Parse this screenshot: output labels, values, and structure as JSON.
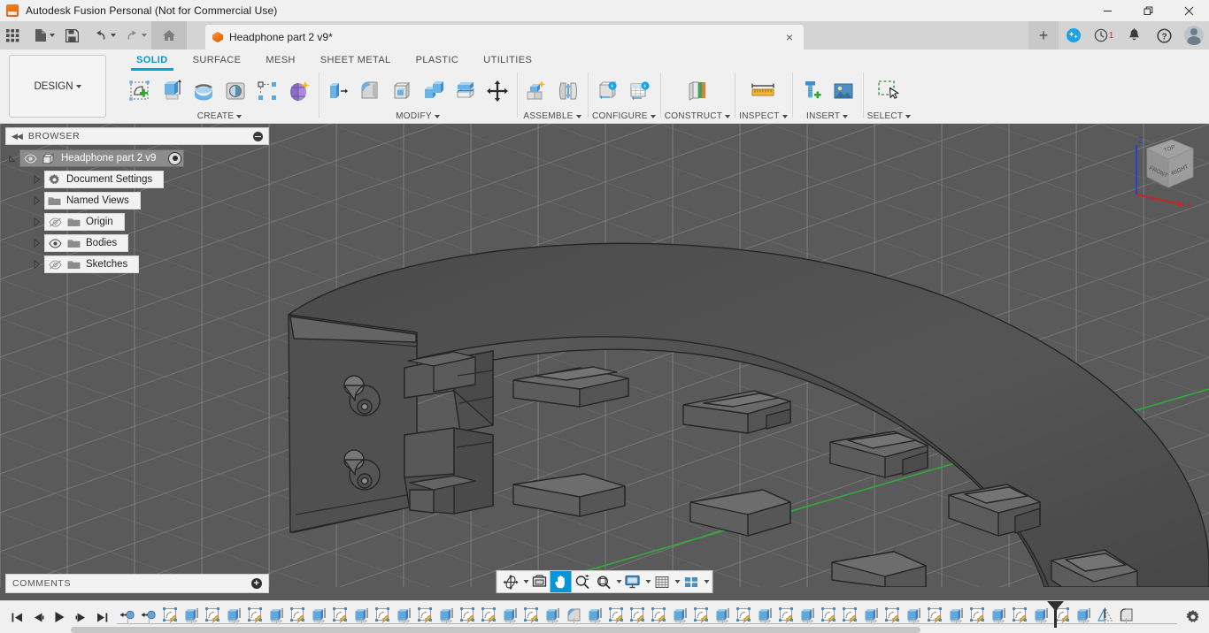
{
  "window": {
    "title": "Autodesk Fusion Personal (Not for Commercial Use)",
    "app_icon": "fusion-logo-icon",
    "minimize_label": "Minimize",
    "restore_label": "Restore",
    "close_label": "Close"
  },
  "quick_access": {
    "items": [
      {
        "name": "app-grid",
        "icon": "grid-apps-icon",
        "has_caret": false
      },
      {
        "name": "new-document",
        "icon": "file-new-icon",
        "has_caret": true
      },
      {
        "name": "save",
        "icon": "save-disk-icon",
        "has_caret": false
      },
      {
        "name": "undo",
        "icon": "undo-arrow-icon",
        "has_caret": true
      },
      {
        "name": "redo",
        "icon": "redo-arrow-icon",
        "has_caret": true
      },
      {
        "name": "home",
        "icon": "home-icon",
        "has_caret": false
      }
    ],
    "document_tab": {
      "icon": "orange-cube-icon",
      "label": "Headphone part 2 v9*",
      "close_label": "×"
    },
    "new_tab_label": "+",
    "right_icons": [
      {
        "name": "extensions",
        "icon": "sparkle-badge-icon",
        "badge": ""
      },
      {
        "name": "job-status",
        "icon": "clock-icon",
        "badge": "1"
      },
      {
        "name": "notifications",
        "icon": "bell-icon",
        "badge": ""
      },
      {
        "name": "help",
        "icon": "question-circle-icon",
        "badge": ""
      },
      {
        "name": "account",
        "icon": "avatar-icon",
        "badge": ""
      }
    ]
  },
  "ribbon": {
    "workspace_label": "DESIGN",
    "tabs": [
      {
        "label": "SOLID",
        "active": true
      },
      {
        "label": "SURFACE",
        "active": false
      },
      {
        "label": "MESH",
        "active": false
      },
      {
        "label": "SHEET METAL",
        "active": false
      },
      {
        "label": "PLASTIC",
        "active": false
      },
      {
        "label": "UTILITIES",
        "active": false
      }
    ],
    "active_tab_color": "#0696d7",
    "panels": [
      {
        "label": "CREATE",
        "has_caret": true,
        "icons": [
          {
            "name": "create-sketch-icon"
          },
          {
            "name": "extrude-icon"
          },
          {
            "name": "revolve-icon"
          },
          {
            "name": "sweep-icon"
          },
          {
            "name": "pattern-icon"
          },
          {
            "name": "form-icon"
          }
        ]
      },
      {
        "label": "MODIFY",
        "has_caret": true,
        "icons": [
          {
            "name": "press-pull-icon"
          },
          {
            "name": "fillet-icon"
          },
          {
            "name": "shell-icon"
          },
          {
            "name": "combine-icon"
          },
          {
            "name": "split-face-icon"
          },
          {
            "name": "move-copy-icon"
          }
        ]
      },
      {
        "label": "ASSEMBLE",
        "has_caret": true,
        "icons": [
          {
            "name": "new-component-icon"
          },
          {
            "name": "joint-icon"
          }
        ]
      },
      {
        "label": "CONFIGURE",
        "has_caret": true,
        "icons": [
          {
            "name": "configuration-icon"
          },
          {
            "name": "configuration-table-icon"
          }
        ]
      },
      {
        "label": "CONSTRUCT",
        "has_caret": true,
        "icons": [
          {
            "name": "offset-plane-icon"
          }
        ]
      },
      {
        "label": "INSPECT",
        "has_caret": true,
        "icons": [
          {
            "name": "measure-ruler-icon"
          }
        ]
      },
      {
        "label": "INSERT",
        "has_caret": true,
        "icons": [
          {
            "name": "insert-mcmaster-icon"
          },
          {
            "name": "insert-canvas-icon"
          }
        ]
      },
      {
        "label": "SELECT",
        "has_caret": true,
        "icons": [
          {
            "name": "window-selection-icon"
          }
        ]
      }
    ]
  },
  "browser": {
    "header_label": "BROWSER",
    "collapse_icon": "double-chevron-left-icon",
    "minimize_icon": "minus-circle-icon",
    "tree": [
      {
        "label": "Headphone part 2 v9",
        "level": 0,
        "icon": "component-cube-icon",
        "arrow": "expanded",
        "visibility": "visible",
        "selected": true,
        "has_activate_radio": true
      },
      {
        "label": "Document Settings",
        "level": 1,
        "icon": "gear-icon",
        "arrow": "collapsed",
        "visibility": "none",
        "selected": false,
        "has_activate_radio": false
      },
      {
        "label": "Named Views",
        "level": 1,
        "icon": "folder-icon",
        "arrow": "collapsed",
        "visibility": "none",
        "selected": false,
        "has_activate_radio": false
      },
      {
        "label": "Origin",
        "level": 1,
        "icon": "folder-icon",
        "arrow": "collapsed",
        "visibility": "hidden",
        "selected": false,
        "has_activate_radio": false
      },
      {
        "label": "Bodies",
        "level": 1,
        "icon": "folder-icon",
        "arrow": "collapsed",
        "visibility": "visible",
        "selected": false,
        "has_activate_radio": false
      },
      {
        "label": "Sketches",
        "level": 1,
        "icon": "folder-icon",
        "arrow": "collapsed",
        "visibility": "hidden",
        "selected": false,
        "has_activate_radio": false
      }
    ]
  },
  "comments": {
    "label": "COMMENTS",
    "add_icon": "plus-circle-icon",
    "add_label": "+"
  },
  "viewcube": {
    "top_face_label": "TOP",
    "front_face_label": "FRONT",
    "right_face_label": "RIGHT",
    "axis_z_label": "Z",
    "axis_x_label": "X",
    "axis_z_color": "#2a3fd0",
    "axis_x_color": "#c0282d"
  },
  "navbar": {
    "items": [
      {
        "name": "orbit-button",
        "icon": "orbit-icon",
        "caret": true,
        "selected": false
      },
      {
        "name": "look-at-button",
        "icon": "look-at-icon",
        "caret": false,
        "selected": false
      },
      {
        "name": "pan-button",
        "icon": "pan-hand-icon",
        "caret": false,
        "selected": true
      },
      {
        "name": "zoom-button",
        "icon": "zoom-magnifier-icon",
        "caret": false,
        "selected": false
      },
      {
        "name": "fit-button",
        "icon": "fit-view-icon",
        "caret": true,
        "selected": false
      },
      {
        "name": "display-settings-button",
        "icon": "monitor-icon",
        "caret": true,
        "selected": false
      },
      {
        "name": "grid-snaps-button",
        "icon": "grid-icon",
        "caret": true,
        "selected": false
      },
      {
        "name": "viewports-button",
        "icon": "viewports-icon",
        "caret": true,
        "selected": false
      }
    ]
  },
  "viewport": {
    "background_color": "#5a5a5a",
    "model_color": "#4a4a4a",
    "grid_line_color": "#8c8c8c",
    "y_axis_color": "#2faf38",
    "model_name": "headphone-band-3d-model"
  },
  "timeline": {
    "playback": [
      {
        "name": "go-to-beginning-button",
        "icon": "skip-start-icon"
      },
      {
        "name": "step-back-button",
        "icon": "step-back-icon"
      },
      {
        "name": "play-button",
        "icon": "play-icon"
      },
      {
        "name": "step-forward-button",
        "icon": "step-forward-icon"
      },
      {
        "name": "go-to-end-button",
        "icon": "skip-end-icon"
      }
    ],
    "settings_icon": "gear-icon",
    "features": [
      "move-copy-icon",
      "move-copy-icon",
      "sketch-icon",
      "extrude-icon",
      "sketch-icon",
      "extrude-icon",
      "sketch-icon",
      "extrude-icon",
      "sketch-icon",
      "extrude-icon",
      "sketch-icon",
      "extrude-icon",
      "sketch-icon",
      "extrude-icon",
      "sketch-icon",
      "extrude-icon",
      "sketch-icon",
      "sketch-icon",
      "extrude-icon",
      "sketch-icon",
      "extrude-icon",
      "fillet-icon",
      "extrude-icon",
      "sketch-icon",
      "sketch-icon",
      "sketch-icon",
      "extrude-icon",
      "sketch-icon",
      "extrude-icon",
      "sketch-icon",
      "extrude-icon",
      "sketch-icon",
      "extrude-icon",
      "sketch-icon",
      "sketch-icon",
      "extrude-icon",
      "sketch-icon",
      "extrude-icon",
      "sketch-icon",
      "extrude-icon",
      "sketch-icon",
      "extrude-icon",
      "sketch-icon",
      "extrude-icon",
      "sketch-icon",
      "extrude-icon",
      "mirror-icon",
      "fillet-body-icon"
    ]
  }
}
